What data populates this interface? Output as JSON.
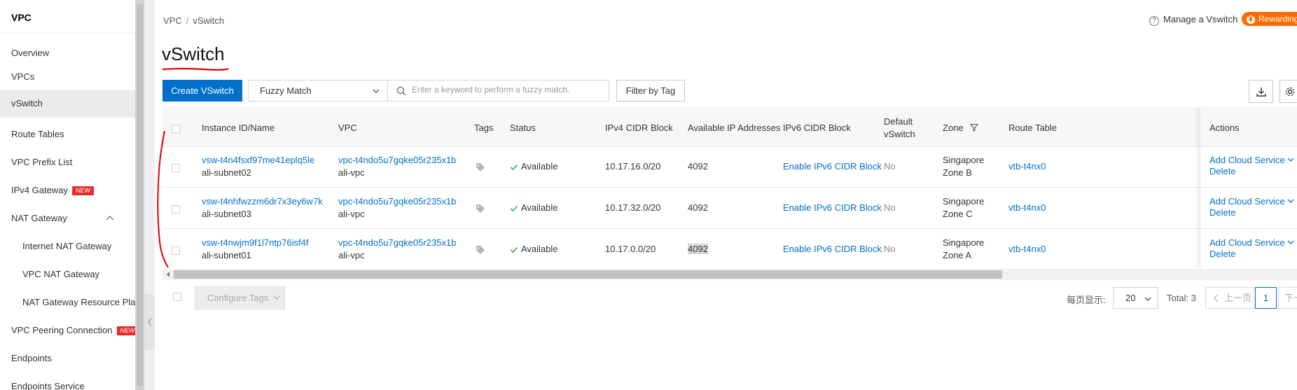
{
  "sidebar": {
    "title": "VPC",
    "items": [
      {
        "label": "Overview"
      },
      {
        "label": "VPCs"
      },
      {
        "label": "vSwitch"
      },
      {
        "label": "Route Tables"
      },
      {
        "label": "VPC Prefix List"
      },
      {
        "label": "IPv4 Gateway",
        "badge": "NEW"
      },
      {
        "label": "NAT Gateway"
      },
      {
        "label": "Internet NAT Gateway"
      },
      {
        "label": "VPC NAT Gateway"
      },
      {
        "label": "NAT Gateway Resource Plan"
      },
      {
        "label": "VPC Peering Connection",
        "badge": "NEW"
      },
      {
        "label": "Endpoints"
      },
      {
        "label": "Endpoints Service"
      }
    ]
  },
  "breadcrumb": {
    "root": "VPC",
    "sep": "/",
    "current": "vSwitch"
  },
  "page_title": "vSwitch",
  "header": {
    "manage_label": "Manage a Vswitch",
    "reward_label": "Rewarding"
  },
  "toolbar": {
    "create_label": "Create VSwitch",
    "match_value": "Fuzzy Match",
    "search_placeholder": "Enter a keyword to perform a fuzzy match.",
    "filter_tag_label": "Filter by Tag"
  },
  "table": {
    "headers": {
      "instance": "Instance ID/Name",
      "vpc": "VPC",
      "tags": "Tags",
      "status": "Status",
      "ipv4": "IPv4 CIDR Block",
      "available_ip": "Available IP Addresses",
      "ipv6": "IPv6 CIDR Block",
      "default_1": "Default",
      "default_2": "vSwitch",
      "zone": "Zone",
      "route": "Route Table",
      "actions": "Actions"
    },
    "rows": [
      {
        "id": "vsw-t4n4fsxf97me41eplq5le",
        "name": "ali-subnet02",
        "vpc_id": "vpc-t4ndo5u7gqke05r235x1b",
        "vpc_name": "ali-vpc",
        "status": "Available",
        "ipv4": "10.17.16.0/20",
        "available_ip": "4092",
        "ipv6": "Enable IPv6 CIDR Block",
        "default": "No",
        "zone_1": "Singapore",
        "zone_2": "Zone B",
        "route": "vtb-t4nx0",
        "action_1": "Add Cloud Service",
        "action_2": "Delete"
      },
      {
        "id": "vsw-t4nhfwzzm6dr7x3ey6w7k",
        "name": "ali-subnet03",
        "vpc_id": "vpc-t4ndo5u7gqke05r235x1b",
        "vpc_name": "ali-vpc",
        "status": "Available",
        "ipv4": "10.17.32.0/20",
        "available_ip": "4092",
        "ipv6": "Enable IPv6 CIDR Block",
        "default": "No",
        "zone_1": "Singapore",
        "zone_2": "Zone C",
        "route": "vtb-t4nx0",
        "action_1": "Add Cloud Service",
        "action_2": "Delete"
      },
      {
        "id": "vsw-t4nwjm9f1l7ntp76isf4f",
        "name": "ali-subnet01",
        "vpc_id": "vpc-t4ndo5u7gqke05r235x1b",
        "vpc_name": "ali-vpc",
        "status": "Available",
        "ipv4": "10.17.0.0/20",
        "available_ip": "4092",
        "ipv6": "Enable IPv6 CIDR Block",
        "default": "No",
        "zone_1": "Singapore",
        "zone_2": "Zone A",
        "route": "vtb-t4nx0",
        "action_1": "Add Cloud Service",
        "action_2": "Delete"
      }
    ]
  },
  "footer": {
    "config_tags_label": "Configure Tags",
    "per_page_label": "每页显示:",
    "per_page_value": "20",
    "total": "Total: 3",
    "prev_label": "上一页",
    "page_current": "1",
    "next_label": "下一页"
  },
  "colors": {
    "accent": "#0070cc",
    "reward": "#ff6a00",
    "badge": "#e52a2a",
    "status_ok": "#2fa84f",
    "annotation": "#e00000"
  }
}
